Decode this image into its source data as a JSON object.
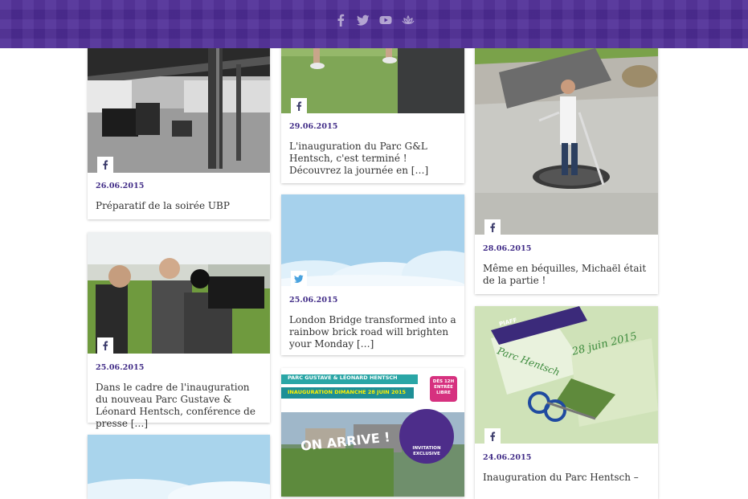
{
  "header": {
    "social": [
      "facebook-icon",
      "twitter-icon",
      "youtube-icon",
      "lotus-logo-icon"
    ]
  },
  "colors": {
    "header_bg": "#4f2d97",
    "date": "#3f2a86",
    "text": "#333333",
    "twitter": "#4aa3df"
  },
  "posts": [
    {
      "date": "26.06.2015",
      "title": "Préparatif de la soirée UBP",
      "source": "facebook-icon"
    },
    {
      "date": "25.06.2015",
      "title": "Dans le cadre de l'inauguration du nouveau Parc Gustave & Léonard Hentsch, conférence de presse […]",
      "source": "facebook-icon"
    },
    {
      "date": "29.06.2015",
      "title": "L'inauguration du Parc G&L Hentsch, c'est terminé ! Découvrez la journée en […]",
      "source": "facebook-icon"
    },
    {
      "date": "25.06.2015",
      "title": "London Bridge transformed into a rainbow brick road will brighten your Monday […]",
      "source": "twitter-icon"
    },
    {
      "poster": {
        "heading": "PARC GUSTAVE & LÉONARD HENTSCH",
        "subheading": "INAUGURATION DIMANCHE 28 JUIN 2015",
        "badge": "DÈS 12H ENTRÉE LIBRE",
        "slogan": "ON ARRIVE !",
        "invite": "INVITATION EXCLUSIVE"
      },
      "source": "none"
    },
    {
      "date": "28.06.2015",
      "title": "Même en béquilles, Michaël était de la partie !",
      "source": "facebook-icon"
    },
    {
      "date": "24.06.2015",
      "title": "Inauguration du Parc Hentsch –",
      "source": "facebook-icon"
    }
  ],
  "photo_text": {
    "ribbon": "PIAFF",
    "handwriting_line1": "28 juin 2015",
    "handwriting_line2": "Parc Hentsch"
  }
}
